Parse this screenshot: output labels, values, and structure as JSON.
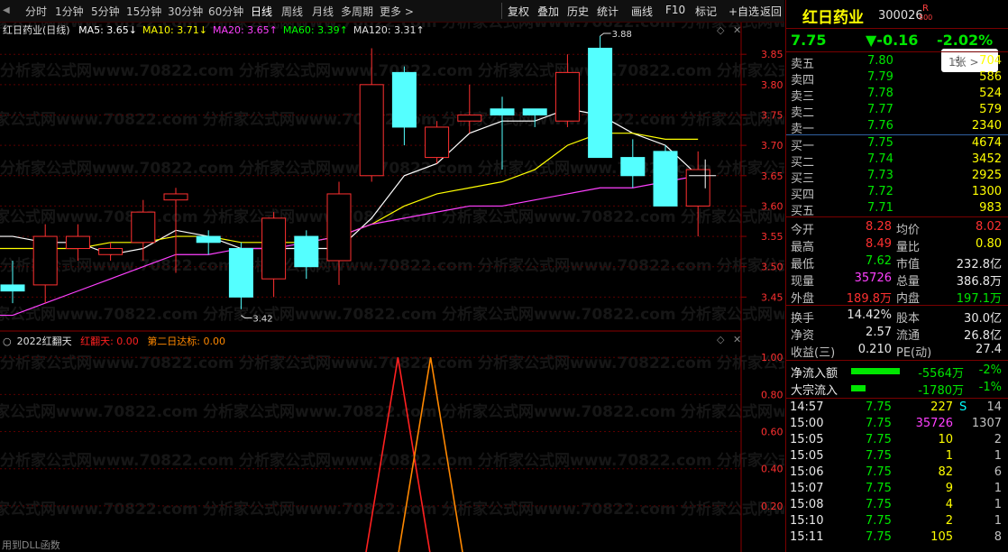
{
  "toolbar": {
    "periods": [
      "分时",
      "1分钟",
      "5分钟",
      "15分钟",
      "30分钟",
      "60分钟",
      "日线",
      "周线",
      "月线",
      "多周期",
      "更多 >"
    ],
    "active_period": "日线",
    "actions": [
      "复权",
      "叠加",
      "历史",
      "统计",
      "画线",
      "F10",
      "标记",
      "+自选",
      "返回"
    ]
  },
  "chart_header": {
    "title": "红日药业(日线)",
    "ma": [
      {
        "label": "MA5: 3.65↓",
        "color": "#ffffff"
      },
      {
        "label": "MA10: 3.71↓",
        "color": "#ffff00"
      },
      {
        "label": "MA20: 3.65↑",
        "color": "#ff40ff"
      },
      {
        "label": "MA60: 3.39↑",
        "color": "#00ff00"
      },
      {
        "label": "MA120: 3.31↑",
        "color": "#e0e0e0"
      }
    ]
  },
  "indicator_header": {
    "name": "2022红翻天",
    "line1": "红翻天: 0.00",
    "line2": "第二日达标: 0.00"
  },
  "chart_data": [
    {
      "type": "candlestick",
      "title": "红日药业(日线)",
      "y_ticks": [
        3.45,
        3.5,
        3.55,
        3.6,
        3.65,
        3.7,
        3.75,
        3.8,
        3.85
      ],
      "ylim": [
        3.4,
        3.88
      ],
      "annotations": [
        {
          "label": "3.88",
          "value": 3.88
        },
        {
          "label": "3.42",
          "value": 3.42
        }
      ],
      "candles": [
        {
          "o": 3.47,
          "c": 3.46,
          "h": 3.51,
          "l": 3.44
        },
        {
          "o": 3.47,
          "c": 3.55,
          "h": 3.57,
          "l": 3.44
        },
        {
          "o": 3.53,
          "c": 3.55,
          "h": 3.57,
          "l": 3.51
        },
        {
          "o": 3.52,
          "c": 3.53,
          "h": 3.54,
          "l": 3.51
        },
        {
          "o": 3.54,
          "c": 3.59,
          "h": 3.61,
          "l": 3.51
        },
        {
          "o": 3.61,
          "c": 3.62,
          "h": 3.63,
          "l": 3.49
        },
        {
          "o": 3.55,
          "c": 3.54,
          "h": 3.56,
          "l": 3.52
        },
        {
          "o": 3.53,
          "c": 3.45,
          "h": 3.54,
          "l": 3.43
        },
        {
          "o": 3.48,
          "c": 3.58,
          "h": 3.59,
          "l": 3.45
        },
        {
          "o": 3.55,
          "c": 3.5,
          "h": 3.56,
          "l": 3.48
        },
        {
          "o": 3.51,
          "c": 3.62,
          "h": 3.64,
          "l": 3.47
        },
        {
          "o": 3.65,
          "c": 3.8,
          "h": 3.86,
          "l": 3.64
        },
        {
          "o": 3.82,
          "c": 3.73,
          "h": 3.83,
          "l": 3.7
        },
        {
          "o": 3.68,
          "c": 3.73,
          "h": 3.74,
          "l": 3.67
        },
        {
          "o": 3.74,
          "c": 3.75,
          "h": 3.8,
          "l": 3.72
        },
        {
          "o": 3.76,
          "c": 3.75,
          "h": 3.78,
          "l": 3.66
        },
        {
          "o": 3.76,
          "c": 3.75,
          "h": 3.76,
          "l": 3.73
        },
        {
          "o": 3.74,
          "c": 3.82,
          "h": 3.85,
          "l": 3.73
        },
        {
          "o": 3.86,
          "c": 3.68,
          "h": 3.88,
          "l": 3.68
        },
        {
          "o": 3.68,
          "c": 3.65,
          "h": 3.71,
          "l": 3.63
        },
        {
          "o": 3.69,
          "c": 3.6,
          "h": 3.7,
          "l": 3.6
        },
        {
          "o": 3.6,
          "c": 3.66,
          "h": 3.69,
          "l": 3.55
        }
      ],
      "series": [
        {
          "name": "MA5",
          "color": "#ffffff",
          "values": [
            3.55,
            3.54,
            3.54,
            3.52,
            3.53,
            3.56,
            3.55,
            3.53,
            3.53,
            3.53,
            3.53,
            3.58,
            3.65,
            3.67,
            3.72,
            3.74,
            3.74,
            3.76,
            3.75,
            3.72,
            3.7,
            3.65
          ]
        },
        {
          "name": "MA10",
          "color": "#ffff00",
          "values": [
            3.53,
            3.53,
            3.53,
            3.54,
            3.54,
            3.55,
            3.55,
            3.54,
            3.54,
            3.54,
            3.55,
            3.57,
            3.6,
            3.62,
            3.63,
            3.64,
            3.66,
            3.7,
            3.72,
            3.72,
            3.71,
            3.71
          ]
        },
        {
          "name": "MA20",
          "color": "#ff40ff",
          "values": [
            3.42,
            3.44,
            3.46,
            3.48,
            3.5,
            3.52,
            3.52,
            3.53,
            3.53,
            3.54,
            3.55,
            3.57,
            3.58,
            3.59,
            3.6,
            3.6,
            3.61,
            3.62,
            3.63,
            3.63,
            3.64,
            3.65
          ]
        }
      ]
    },
    {
      "type": "line",
      "title": "2022红翻天",
      "y_ticks": [
        0.2,
        0.4,
        0.6,
        0.8,
        1.0
      ],
      "ylim": [
        0,
        1.04
      ],
      "series": [
        {
          "name": "红翻天",
          "color": "#ff2020",
          "values": [
            0,
            0,
            0,
            0,
            0,
            0,
            0,
            0,
            0,
            0,
            0,
            0,
            1,
            0,
            0,
            0,
            0,
            0,
            0,
            0,
            0,
            0
          ]
        },
        {
          "name": "第二日达标",
          "color": "#ff8800",
          "values": [
            0,
            0,
            0,
            0,
            0,
            0,
            0,
            0,
            0,
            0,
            0,
            0,
            0,
            1,
            0,
            0,
            0,
            0,
            0,
            0,
            0,
            0
          ]
        }
      ]
    }
  ],
  "stock": {
    "name": "红日药业",
    "code": "300026",
    "badge": "R",
    "badge_sub": "500",
    "price": "7.75",
    "change": "▼-0.16",
    "change_pct": "-2.02%",
    "popup": "1张 >"
  },
  "asks": [
    {
      "label": "卖五",
      "price": "7.80",
      "vol": "704"
    },
    {
      "label": "卖四",
      "price": "7.79",
      "vol": "586"
    },
    {
      "label": "卖三",
      "price": "7.78",
      "vol": "524"
    },
    {
      "label": "卖二",
      "price": "7.77",
      "vol": "579"
    },
    {
      "label": "卖一",
      "price": "7.76",
      "vol": "2340"
    }
  ],
  "bids": [
    {
      "label": "买一",
      "price": "7.75",
      "vol": "4674"
    },
    {
      "label": "买二",
      "price": "7.74",
      "vol": "3452"
    },
    {
      "label": "买三",
      "price": "7.73",
      "vol": "2925"
    },
    {
      "label": "买四",
      "price": "7.72",
      "vol": "1300"
    },
    {
      "label": "买五",
      "price": "7.71",
      "vol": "983"
    }
  ],
  "stats": [
    {
      "l1": "今开",
      "v1": "8.28",
      "c1": "red",
      "l2": "均价",
      "v2": "8.02",
      "c2": "red"
    },
    {
      "l1": "最高",
      "v1": "8.49",
      "c1": "red",
      "l2": "量比",
      "v2": "0.80",
      "c2": "yellow"
    },
    {
      "l1": "最低",
      "v1": "7.62",
      "c1": "green",
      "l2": "市值",
      "v2": "232.8亿",
      "c2": "white"
    },
    {
      "l1": "现量",
      "v1": "35726",
      "c1": "mag",
      "l2": "总量",
      "v2": "386.8万",
      "c2": "white"
    },
    {
      "l1": "外盘",
      "v1": "189.8万",
      "c1": "red",
      "l2": "内盘",
      "v2": "197.1万",
      "c2": "green"
    }
  ],
  "stats2": [
    {
      "l1": "换手",
      "v1": "14.42%",
      "l2": "股本",
      "v2": "30.0亿"
    },
    {
      "l1": "净资",
      "v1": "2.57",
      "l2": "流通",
      "v2": "26.8亿"
    },
    {
      "l1": "收益(三)",
      "v1": "0.210",
      "l2": "PE(动)",
      "v2": "27.4"
    }
  ],
  "flows": [
    {
      "label": "净流入额",
      "value": "-5564万",
      "pct": "-2%",
      "bar": 0.75
    },
    {
      "label": "大宗流入",
      "value": "-1780万",
      "pct": "-1%",
      "bar": 0.22
    }
  ],
  "ticks": [
    {
      "time": "14:57",
      "price": "7.75",
      "vol": "227",
      "flag": "S",
      "n": "14",
      "vc": "yellow"
    },
    {
      "time": "15:00",
      "price": "7.75",
      "vol": "35726",
      "flag": "",
      "n": "1307",
      "vc": "mag"
    },
    {
      "time": "15:05",
      "price": "7.75",
      "vol": "10",
      "flag": "",
      "n": "2",
      "vc": "yellow"
    },
    {
      "time": "15:05",
      "price": "7.75",
      "vol": "1",
      "flag": "",
      "n": "1",
      "vc": "yellow"
    },
    {
      "time": "15:06",
      "price": "7.75",
      "vol": "82",
      "flag": "",
      "n": "6",
      "vc": "yellow"
    },
    {
      "time": "15:07",
      "price": "7.75",
      "vol": "9",
      "flag": "",
      "n": "1",
      "vc": "yellow"
    },
    {
      "time": "15:08",
      "price": "7.75",
      "vol": "4",
      "flag": "",
      "n": "1",
      "vc": "yellow"
    },
    {
      "time": "15:10",
      "price": "7.75",
      "vol": "2",
      "flag": "",
      "n": "1",
      "vc": "yellow"
    },
    {
      "time": "15:11",
      "price": "7.75",
      "vol": "105",
      "flag": "",
      "n": "8",
      "vc": "yellow"
    }
  ],
  "status": "用到DLL函数",
  "watermark": "分析家公式网www.70822.com"
}
